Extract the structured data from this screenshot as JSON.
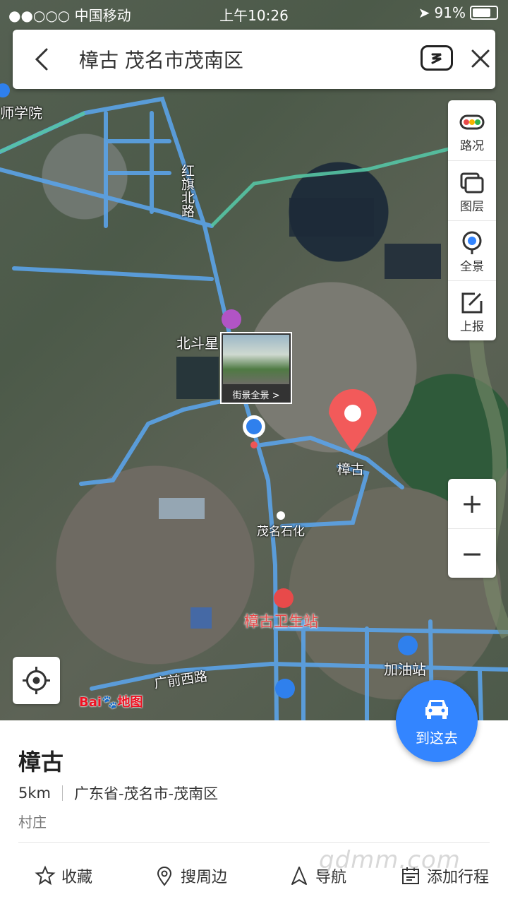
{
  "status_bar": {
    "carrier": "●●○○○ 中国移动",
    "time": "上午10:26",
    "battery_text": "91%",
    "battery_level": 0.91
  },
  "search": {
    "query": "樟古 茂名市茂南区",
    "back_icon": "chevron-left-icon",
    "voice_icon": "voice-icon",
    "close_icon": "close-icon"
  },
  "map_tools": [
    {
      "label": "路况",
      "icon": "traffic-icon"
    },
    {
      "label": "图层",
      "icon": "layers-icon"
    },
    {
      "label": "全景",
      "icon": "panorama-icon"
    },
    {
      "label": "上报",
      "icon": "report-icon"
    }
  ],
  "zoom": {
    "in": "+",
    "out": "−"
  },
  "map_labels": {
    "school": "师学院",
    "road_hongqi": "红旗北路",
    "beidou": "北斗星",
    "street_view": "街景全景 >",
    "zhanggu": "樟古",
    "maoming_shihua": "茂名石化",
    "clinic": "樟古卫生站",
    "gas_station": "加油站",
    "road_guangqian": "广前西路"
  },
  "logo": {
    "text1": "Bai",
    "text2": "地图"
  },
  "go_button": {
    "label": "到这去",
    "icon": "car-icon"
  },
  "place": {
    "name": "樟古",
    "distance": "5km",
    "address": "广东省-茂名市-茂南区",
    "type": "村庄"
  },
  "actions": [
    {
      "label": "收藏",
      "icon": "star-icon"
    },
    {
      "label": "搜周边",
      "icon": "location-pin-icon"
    },
    {
      "label": "导航",
      "icon": "navigation-icon"
    },
    {
      "label": "添加行程",
      "icon": "calendar-icon"
    }
  ],
  "watermark": "gdmm.com"
}
